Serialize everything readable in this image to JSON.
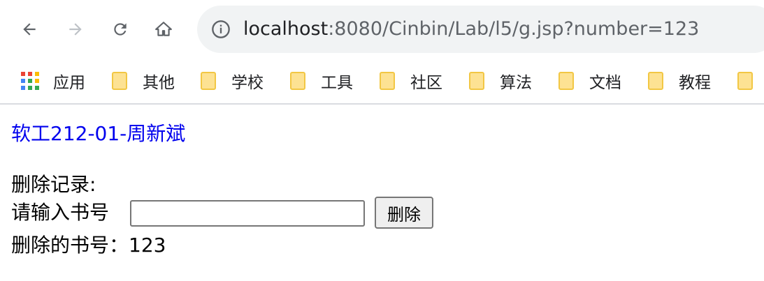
{
  "browser": {
    "url_host": "localhost",
    "url_rest": ":8080/Cinbin/Lab/l5/g.jsp?number=123",
    "bookmarks": [
      {
        "label": "应用",
        "icon": "apps-grid-icon"
      },
      {
        "label": "其他",
        "icon": "folder-icon"
      },
      {
        "label": "学校",
        "icon": "folder-icon"
      },
      {
        "label": "工具",
        "icon": "folder-icon"
      },
      {
        "label": "社区",
        "icon": "folder-icon"
      },
      {
        "label": "算法",
        "icon": "folder-icon"
      },
      {
        "label": "文档",
        "icon": "folder-icon"
      },
      {
        "label": "教程",
        "icon": "folder-icon"
      }
    ]
  },
  "page": {
    "link_text": "软工212-01-周新斌",
    "section_title": "删除记录:",
    "input_label": "请输入书号",
    "input_value": "",
    "delete_button": "删除",
    "result_label": "删除的书号：",
    "result_value": "123"
  },
  "colors": {
    "link": "#0000ee",
    "folder_fill": "#fde293",
    "folder_stroke": "#f2c744",
    "omnibox_bg": "#f1f3f4"
  }
}
